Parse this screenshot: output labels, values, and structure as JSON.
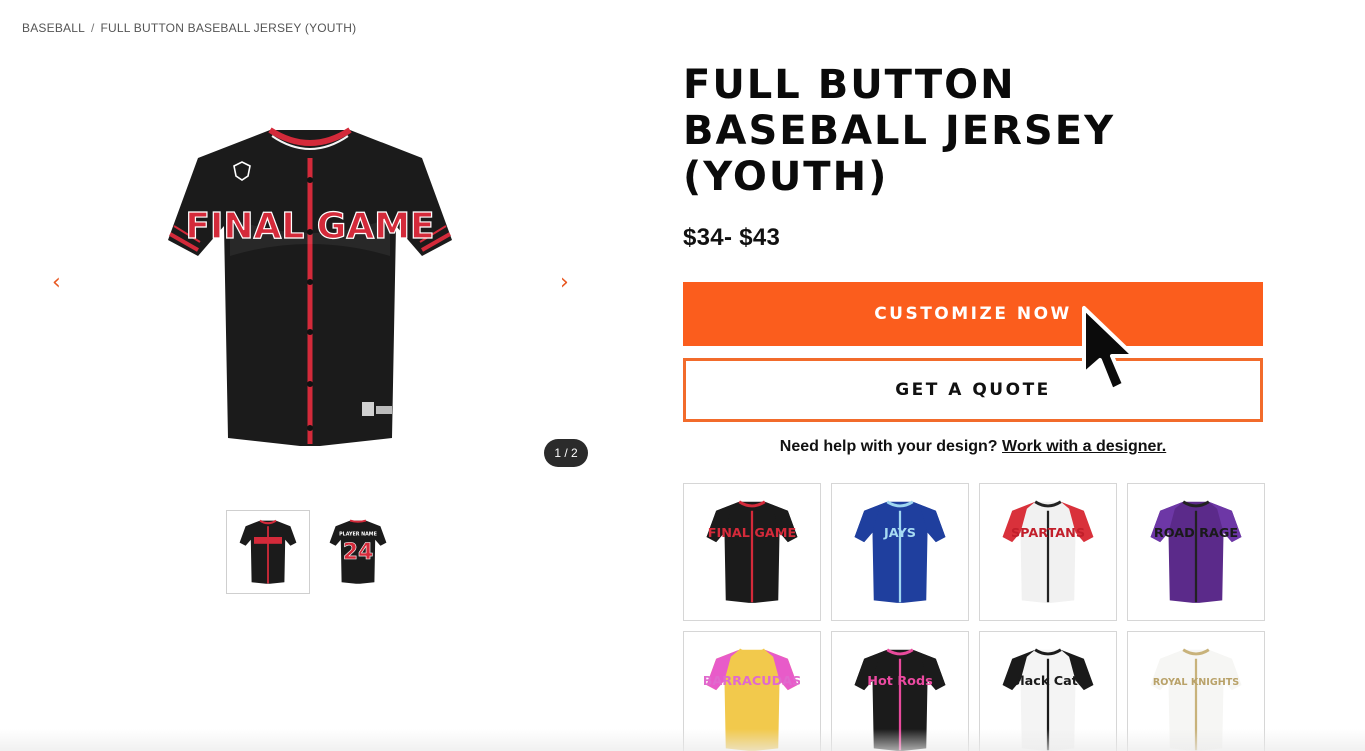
{
  "breadcrumb": {
    "items": [
      "BASEBALL",
      "FULL BUTTON BASEBALL JERSEY (YOUTH)"
    ],
    "separator": "/"
  },
  "gallery": {
    "prev_icon": "‹",
    "next_icon": "›",
    "counter": "1 / 2",
    "main_jersey_text": "FINAL GAME",
    "thumb_back_text": "PLAYER NAME",
    "thumb_back_number": "24"
  },
  "product": {
    "title_line1": "FULL BUTTON",
    "title_line2": "BASEBALL JERSEY",
    "title_line3": "(YOUTH)",
    "price": "$34- $43",
    "customize_label": "CUSTOMIZE NOW",
    "quote_label": "GET A QUOTE",
    "help_text": "Need help with your design?",
    "help_link": "Work with a designer."
  },
  "variants": [
    {
      "body": "#1b1b1b",
      "sleeve": "#1b1b1b",
      "trim": "#d42a3a",
      "text": "FINAL GAME",
      "text_color": "#d42a3a"
    },
    {
      "body": "#1f3f9e",
      "sleeve": "#1f3f9e",
      "trim": "#9fd6f0",
      "text": "JAYS",
      "text_color": "#a7dbf3"
    },
    {
      "body": "#f1f1f1",
      "sleeve": "#d9313b",
      "trim": "#222222",
      "text": "SPARTANS",
      "text_color": "#c21f2b"
    },
    {
      "body": "#5b2a8a",
      "sleeve": "#6d37a6",
      "trim": "#222222",
      "text": "ROAD RAGE",
      "text_color": "#1a1a1a"
    },
    {
      "body": "#f2c94c",
      "sleeve": "#e85bc9",
      "trim": "#f2c94c",
      "text": "BARRACUDAS",
      "text_color": "#e06acd"
    },
    {
      "body": "#1b1b1b",
      "sleeve": "#1b1b1b",
      "trim": "#e84a9c",
      "text": "Hot Rods",
      "text_color": "#ec4aa1"
    },
    {
      "body": "#f4f4f4",
      "sleeve": "#1a1a1a",
      "trim": "#1a1a1a",
      "text": "Black Cats",
      "text_color": "#1a1a1a"
    },
    {
      "body": "#f6f6f4",
      "sleeve": "#f6f6f4",
      "trim": "#c8b27a",
      "text": "ROYAL KNIGHTS",
      "text_color": "#b9a269"
    }
  ],
  "colors": {
    "accent": "#fb5d1d",
    "quote_border": "#f26b2b"
  },
  "icons": {
    "cursor": "arrow-cursor-icon"
  }
}
